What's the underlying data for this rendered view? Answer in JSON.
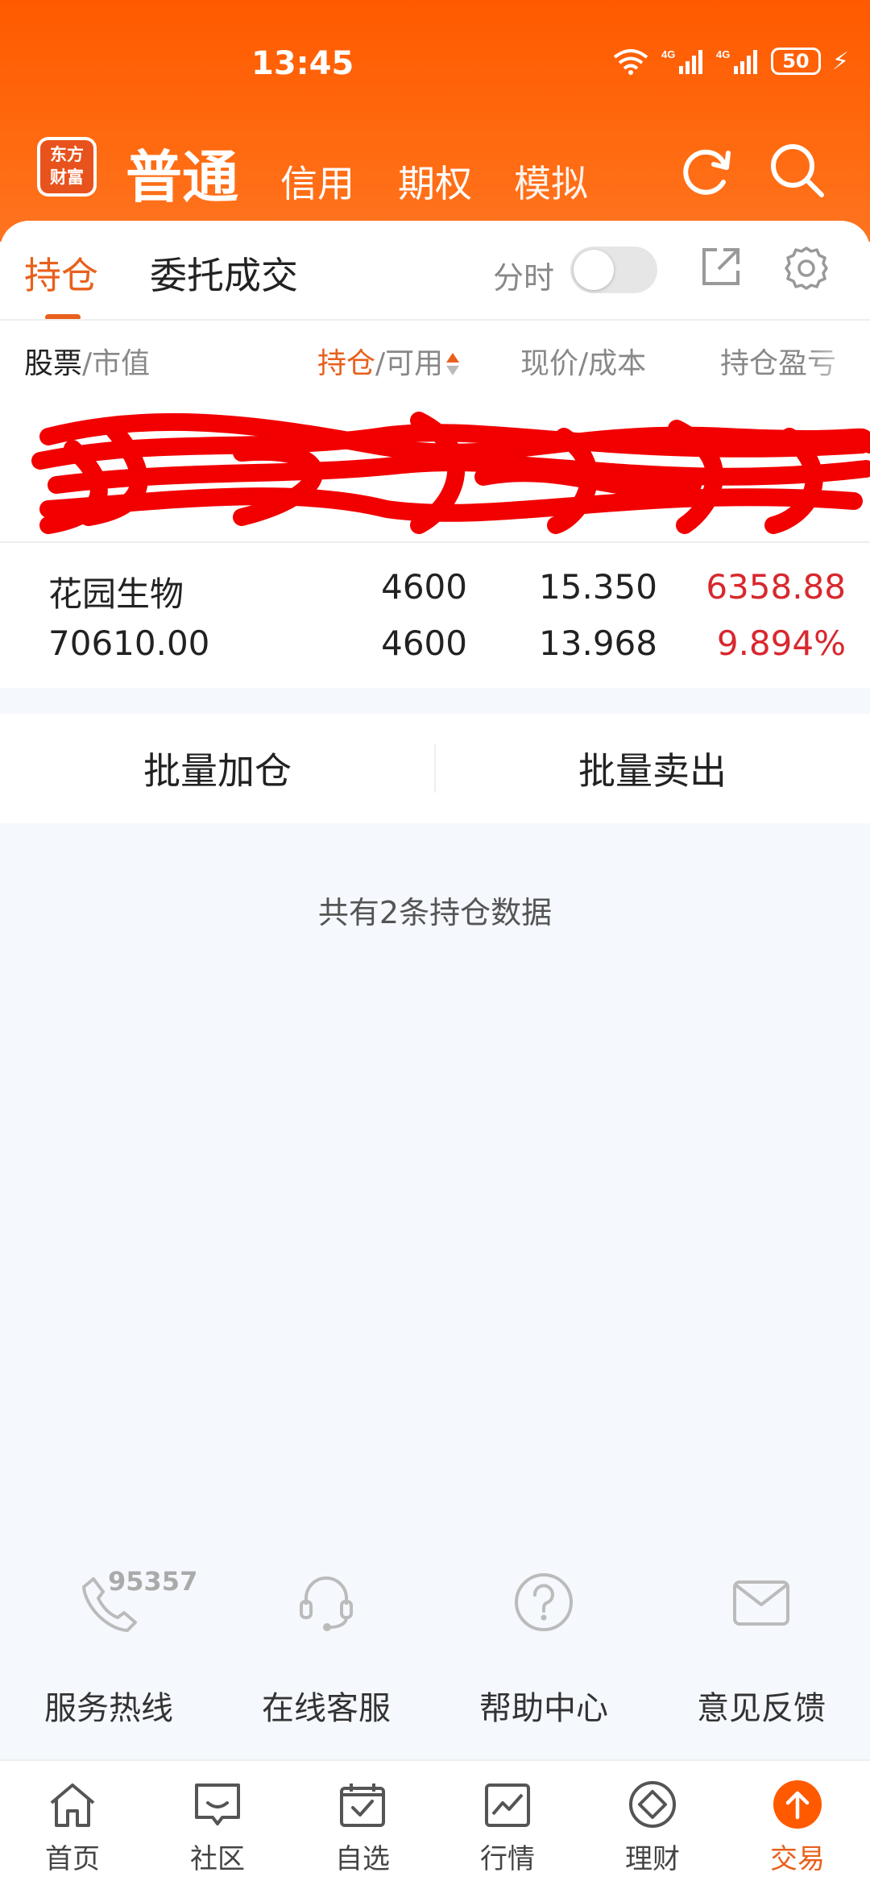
{
  "status_bar": {
    "time": "13:45",
    "network_1": "4G",
    "network_2": "4G",
    "battery": "50"
  },
  "header": {
    "logo_line1": "东方",
    "logo_line2": "财富",
    "tabs": [
      {
        "label": "普通"
      },
      {
        "label": "信用"
      },
      {
        "label": "期权"
      },
      {
        "label": "模拟"
      }
    ]
  },
  "card_tabs": {
    "holdings": "持仓",
    "orders": "委托成交"
  },
  "toggles": {
    "fenshi_label": "分时",
    "fenshi_on": false
  },
  "table": {
    "headers": {
      "stock": "股票",
      "stock_sep": "/市值",
      "position": "持仓",
      "position_sep": "/可用",
      "price": "现价/成本",
      "pnl": "持仓盈亏"
    },
    "rows": [
      {
        "name": "花园生物",
        "market_value": "70610.00",
        "position": "4600",
        "available": "4600",
        "price": "15.350",
        "cost": "13.968",
        "pnl": "6358.88",
        "pnl_pct": "9.894%"
      }
    ]
  },
  "batch": {
    "add": "批量加仓",
    "sell": "批量卖出"
  },
  "summary": "共有2条持仓数据",
  "services": [
    {
      "label": "服务热线",
      "icon": "phone-icon"
    },
    {
      "label": "在线客服",
      "icon": "headset-icon"
    },
    {
      "label": "帮助中心",
      "icon": "help-icon"
    },
    {
      "label": "意见反馈",
      "icon": "mail-icon"
    }
  ],
  "hotline_number": "95357",
  "bottom_nav": [
    {
      "label": "首页",
      "icon": "home-icon"
    },
    {
      "label": "社区",
      "icon": "community-icon"
    },
    {
      "label": "自选",
      "icon": "watchlist-icon"
    },
    {
      "label": "行情",
      "icon": "market-icon"
    },
    {
      "label": "理财",
      "icon": "finance-icon"
    },
    {
      "label": "交易",
      "icon": "trade-icon",
      "active": true
    }
  ],
  "colors": {
    "accent": "#e8601c",
    "header": "#ff5a00",
    "profit": "#d8282e",
    "redaction": "#f20000"
  }
}
